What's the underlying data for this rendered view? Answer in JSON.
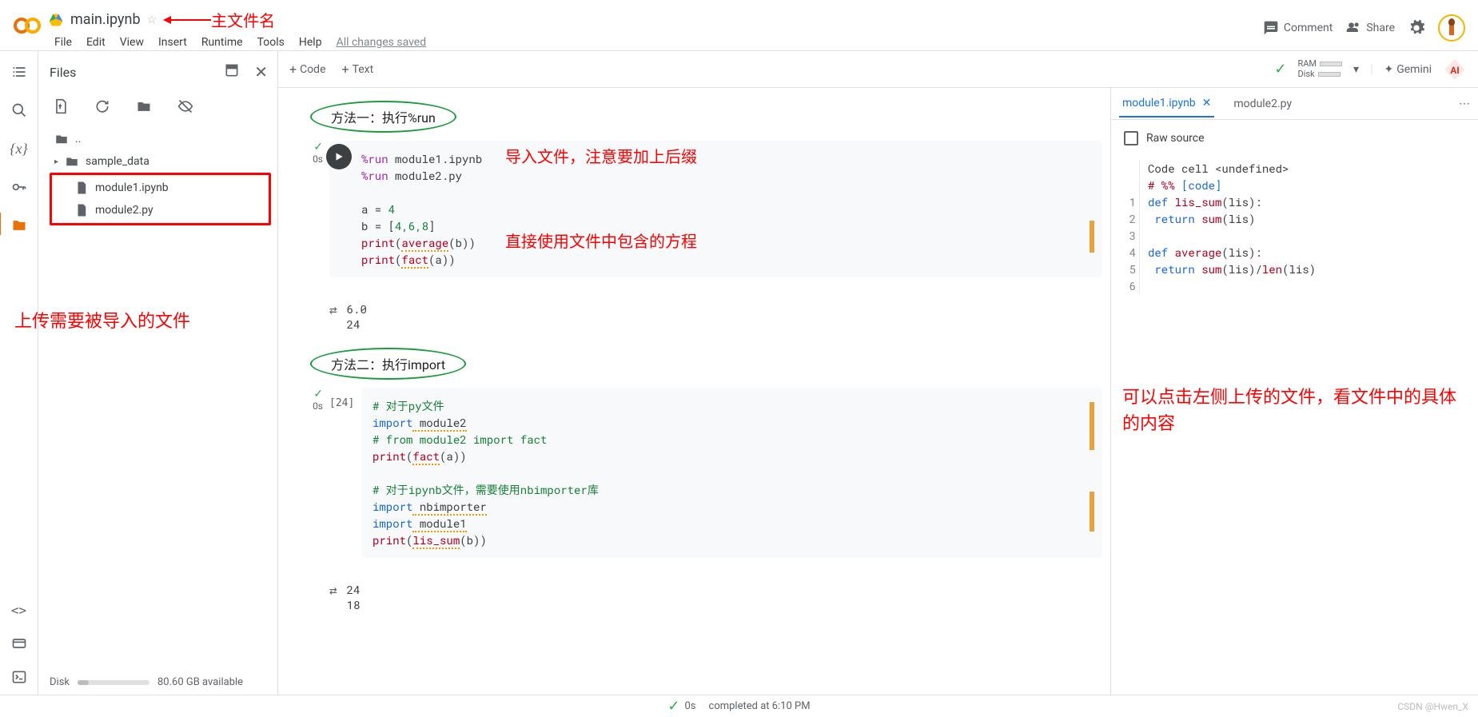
{
  "header": {
    "title": "main.ipynb",
    "annotation_main_file": "主文件名",
    "menu": [
      "File",
      "Edit",
      "View",
      "Insert",
      "Runtime",
      "Tools",
      "Help"
    ],
    "saved_status": "All changes saved",
    "comment": "Comment",
    "share": "Share"
  },
  "files_panel": {
    "title": "Files",
    "parent_dir": "..",
    "folder_sample": "sample_data",
    "file1": "module1.ipynb",
    "file2": "module2.py",
    "disk_label": "Disk",
    "disk_available": "80.60 GB available",
    "annotation_upload": "上传需要被导入的文件"
  },
  "toolbar": {
    "code_btn": "Code",
    "text_btn": "Text",
    "ram_label": "RAM",
    "disk_label": "Disk",
    "gemini_label": "Gemini"
  },
  "headings": {
    "method1": "方法一：执行%run",
    "method2": "方法二：执行import"
  },
  "annotations": {
    "import_note": "导入文件，注意要加上后缀",
    "use_note": "直接使用文件中包含的方程",
    "right_panel_note": "可以点击左侧上传的文件，看文件中的具体的内容"
  },
  "cell1": {
    "exec_time": "0s",
    "line1_cmd": "%run",
    "line1_arg": " module1.ipynb",
    "line2_cmd": "%run",
    "line2_arg": " module2.py",
    "line4": "a = ",
    "line4_val": "4",
    "line5": "b = [",
    "line5_vals": "4,6,8",
    "line5_end": "]",
    "line6_print": "print",
    "line6_fn": "average",
    "line6_arg": "(b))",
    "line7_print": "print",
    "line7_fn": "fact",
    "line7_arg": "(a))",
    "output1": "6.0",
    "output2": "24"
  },
  "cell2": {
    "exec_count": "[24]",
    "exec_time": "0s",
    "c1": "# 对于py文件",
    "c2_kw": "import",
    "c2_mod": " module2",
    "c3": "# from module2 import fact",
    "c4_print": "print",
    "c4_fn": "fact",
    "c4_arg": "(a))",
    "c6": "# 对于ipynb文件，需要使用nbimporter库",
    "c7_kw": "import",
    "c7_mod": " nbimporter",
    "c8_kw": "import",
    "c8_mod": " module1",
    "c9_print": "print",
    "c9_fn": "lis_sum",
    "c9_arg": "(b))",
    "output1": "24",
    "output2": "18"
  },
  "right_panel": {
    "tab1": "module1.ipynb",
    "tab2": "module2.py",
    "raw_source": "Raw source",
    "line0a": "Code cell <undefined>",
    "line0b_hash": "# %%",
    "line0b_code": " [code]",
    "l1_def": "def ",
    "l1_fn": "lis_sum",
    "l1_sig": "(lis):",
    "l2_ret": "    return ",
    "l2_call": "sum",
    "l2_arg": "(lis)",
    "l4_def": "def ",
    "l4_fn": "average",
    "l4_sig": "(lis):",
    "l5_ret": "    return ",
    "l5_call": "sum",
    "l5_mid": "(lis)/",
    "l5_call2": "len",
    "l5_arg2": "(lis)"
  },
  "status_bar": {
    "time": "0s",
    "completed": "completed at 6:10 PM"
  },
  "watermark": "CSDN @Hwen_X"
}
